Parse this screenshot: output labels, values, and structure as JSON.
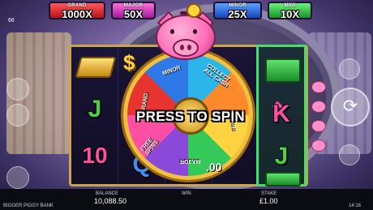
{
  "jackpots": {
    "grand": {
      "label": "GRAND",
      "value": "1000X"
    },
    "major": {
      "label": "MAJOR",
      "value": "50X"
    },
    "minor": {
      "label": "MINOR",
      "value": "25X"
    },
    "mini": {
      "label": "MINI",
      "value": "10X"
    }
  },
  "top_left_indicator": "66",
  "reel_symbols": {
    "reel1": [
      "J",
      "10"
    ],
    "reel2": [
      "Q"
    ],
    "reel4": [
      "K",
      "J"
    ]
  },
  "wheel": {
    "segments": [
      "MINOR",
      "COLLECT ALL CASH",
      "MINI",
      "FREE SPINS",
      "MAJOR",
      "GRAND"
    ],
    "prompt": "PRESS TO SPIN"
  },
  "win_amount_partial": ".00",
  "footer": {
    "game_name": "BIGGER PIGGY BANK",
    "balance_label": "BALANCE",
    "balance_value": "10,088.50",
    "win_label": "WIN",
    "stake_label": "STAKE",
    "stake_value": "£1.00",
    "time": "14:16"
  },
  "colors": {
    "grand": "#e0242c",
    "major": "#d63fc0",
    "minor": "#2f6ae0",
    "mini": "#2fbf44",
    "highlight": "#42e06a"
  }
}
